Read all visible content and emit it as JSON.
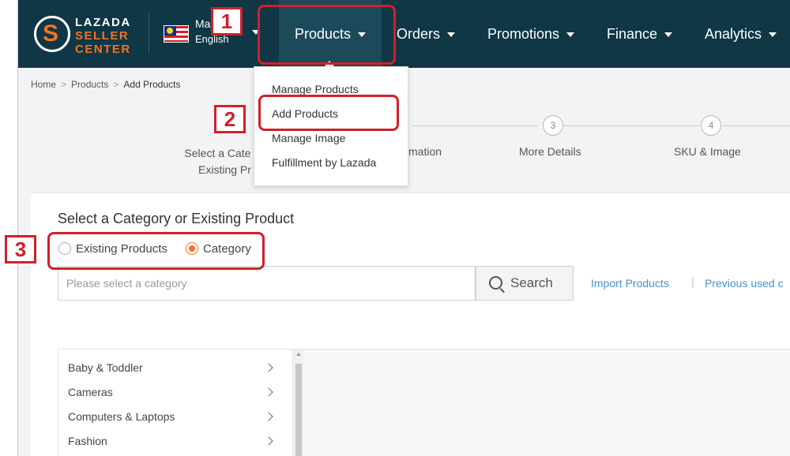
{
  "logo": {
    "line1": "LAZADA",
    "line2": "SELLER",
    "line3": "CENTER",
    "mark": "S"
  },
  "locale": {
    "country": "Ma",
    "language": "English"
  },
  "nav": {
    "products": "Products",
    "orders": "Orders",
    "promotions": "Promotions",
    "finance": "Finance",
    "analytics": "Analytics"
  },
  "products_menu": [
    "Manage Products",
    "Add Products",
    "Manage Image",
    "Fulfillment by Lazada"
  ],
  "breadcrumb": {
    "home": "Home",
    "products": "Products",
    "current": "Add Products",
    "separator": ">"
  },
  "steps": {
    "step1_line1": "Select a Cate",
    "step1_line2": "Existing Pr",
    "step2_label": "mation",
    "step3_number": "3",
    "step3_label": "More Details",
    "step4_number": "4",
    "step4_label": "SKU & Image"
  },
  "card": {
    "title": "Select a Category or Existing Product",
    "radio_existing": "Existing Products",
    "radio_category": "Category",
    "selected_option": "Category",
    "search_placeholder": "Please select a category",
    "search_button": "Search",
    "import_link": "Import Products",
    "link_separator": "|",
    "previous_link": "Previous used c"
  },
  "categories": [
    "Baby & Toddler",
    "Cameras",
    "Computers & Laptops",
    "Fashion"
  ],
  "annotations": {
    "n1": "1",
    "n2": "2",
    "n3": "3",
    "color": "#d0202a"
  },
  "colors": {
    "nav_bg": "#0f3745",
    "accent": "#f57224",
    "link": "#4a90c8"
  }
}
